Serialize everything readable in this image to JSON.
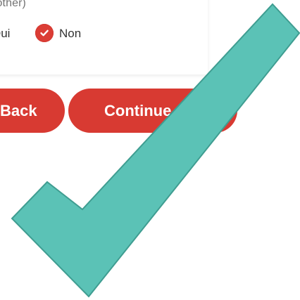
{
  "form": {
    "fragment_text": "/other)",
    "radio_group": {
      "options": [
        {
          "label": "Oui",
          "selected": false
        },
        {
          "label": "Non",
          "selected": true
        }
      ]
    }
  },
  "buttons": {
    "back_label": "Back",
    "continue_label": "Continue"
  },
  "overlay": {
    "checkmark_icon": "checkmark-icon",
    "checkmark_color": "#5bc2b6",
    "accent_color": "#d83a32"
  }
}
